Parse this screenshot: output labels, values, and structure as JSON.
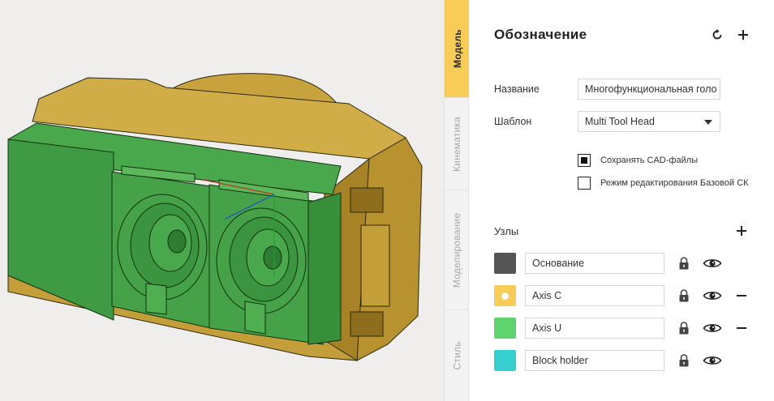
{
  "tabs": [
    {
      "label": "Модель",
      "active": true
    },
    {
      "label": "Кинематика",
      "active": false
    },
    {
      "label": "Моделирование",
      "active": false
    },
    {
      "label": "Стиль",
      "active": false
    }
  ],
  "panel": {
    "title": "Обозначение",
    "reset_icon": "reset-icon",
    "add_icon": "plus-icon",
    "name_label": "Название",
    "name_value": "Многофункциональная голо",
    "template_label": "Шаблон",
    "template_value": "Multi Tool Head",
    "checkboxes": [
      {
        "label": "Сохранять CAD-файлы",
        "checked": true
      },
      {
        "label": "Режим редактирования Базовой СК",
        "checked": false
      }
    ],
    "nodes_label": "Узлы",
    "nodes": [
      {
        "name": "Основание",
        "color": "#555555",
        "removable": false,
        "dot": false
      },
      {
        "name": "Axis C",
        "color": "#f7cc57",
        "removable": true,
        "dot": true
      },
      {
        "name": "Axis U",
        "color": "#5fd36c",
        "removable": true,
        "dot": false
      },
      {
        "name": "Block holder",
        "color": "#35cfcf",
        "removable": false,
        "dot": false
      }
    ]
  },
  "colors": {
    "accent": "#f7cc57",
    "model_green": "#3f9a44",
    "model_gold": "#c9a43a"
  }
}
